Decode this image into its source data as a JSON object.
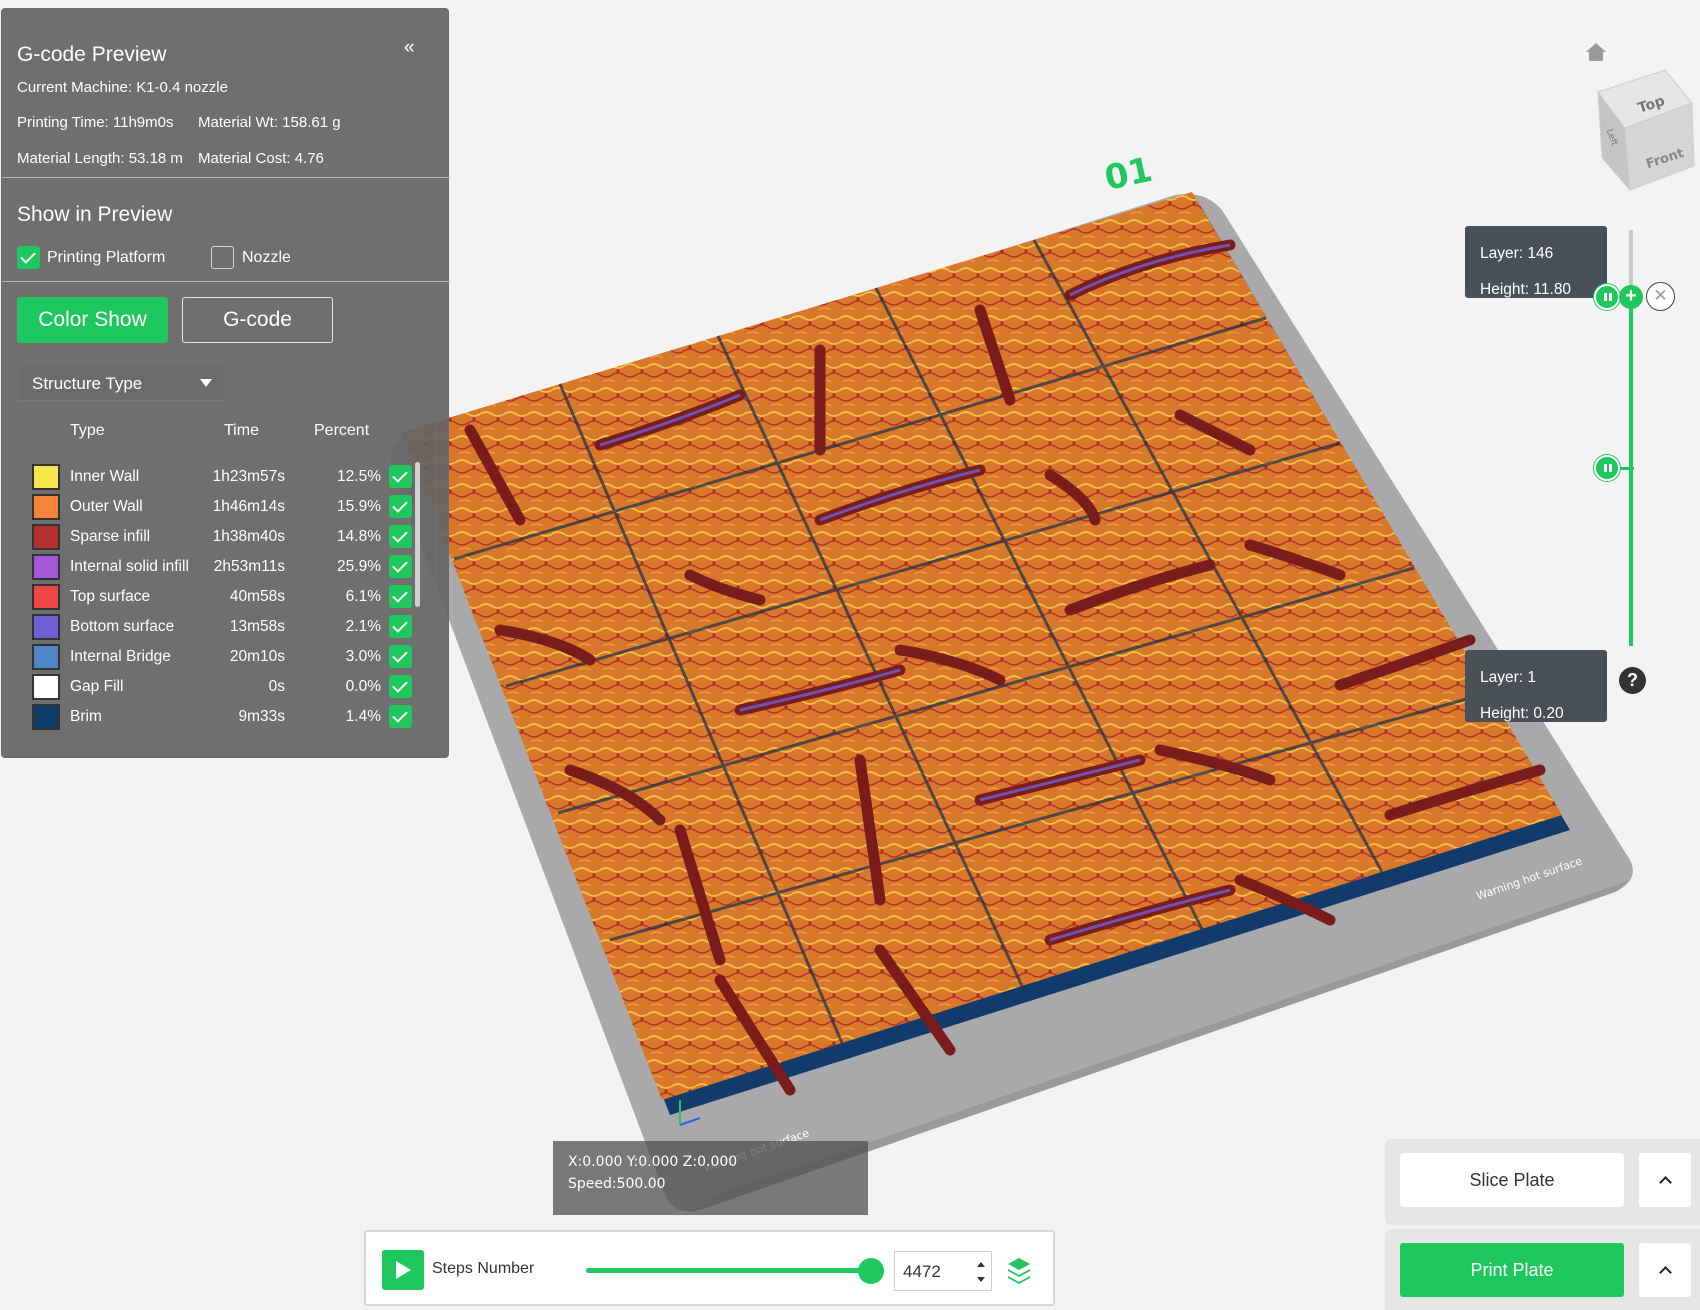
{
  "panel": {
    "title": "G-code Preview",
    "collapse_label": "«",
    "current_machine": "Current Machine: K1-0.4 nozzle",
    "printing_time": "Printing Time: 11h9m0s",
    "material_wt": "Material Wt: 158.61 g",
    "material_length": "Material Length: 53.18 m",
    "material_cost": "Material Cost: 4.76"
  },
  "show_in_preview": {
    "title": "Show in Preview",
    "printing_platform": {
      "label": "Printing Platform",
      "checked": true
    },
    "nozzle": {
      "label": "Nozzle",
      "checked": false
    }
  },
  "tabs": {
    "color_show": "Color Show",
    "gcode": "G-code",
    "active": "Color Show"
  },
  "structure_select": {
    "value": "Structure Type"
  },
  "legend": {
    "headers": {
      "type": "Type",
      "time": "Time",
      "percent": "Percent"
    },
    "rows": [
      {
        "type": "Inner Wall",
        "time": "1h23m57s",
        "percent": "12.5%",
        "color": "#f6e84a",
        "checked": true
      },
      {
        "type": "Outer Wall",
        "time": "1h46m14s",
        "percent": "15.9%",
        "color": "#f5843a",
        "checked": true
      },
      {
        "type": "Sparse infill",
        "time": "1h38m40s",
        "percent": "14.8%",
        "color": "#b3302c",
        "checked": true
      },
      {
        "type": "Internal solid infill",
        "time": "2h53m11s",
        "percent": "25.9%",
        "color": "#a656d8",
        "checked": true
      },
      {
        "type": "Top surface",
        "time": "40m58s",
        "percent": "6.1%",
        "color": "#f24545",
        "checked": true
      },
      {
        "type": "Bottom surface",
        "time": "13m58s",
        "percent": "2.1%",
        "color": "#6f60d8",
        "checked": true
      },
      {
        "type": "Internal Bridge",
        "time": "20m10s",
        "percent": "3.0%",
        "color": "#4f87c6",
        "checked": true
      },
      {
        "type": "Gap Fill",
        "time": "0s",
        "percent": "0.0%",
        "color": "#ffffff",
        "checked": true
      },
      {
        "type": "Brim",
        "time": "9m33s",
        "percent": "1.4%",
        "color": "#0c3b6a",
        "checked": true
      }
    ]
  },
  "layer_slider": {
    "top": {
      "layer": "Layer: 146",
      "height": "Height: 11.80"
    },
    "bottom": {
      "layer": "Layer: 1",
      "height": "Height: 0.20"
    },
    "plus": "+",
    "close": "✕",
    "help": "?"
  },
  "plate": {
    "label": "01",
    "warning": "Warning hot surface"
  },
  "view_cube": {
    "top": "Top",
    "front": "Front",
    "left": "Left"
  },
  "coords": {
    "xyz": "X:0.000  Y:0.000  Z:0.000",
    "speed": "Speed:500.00"
  },
  "steps": {
    "label": "Steps Number",
    "value": "4472",
    "progress": 1.0
  },
  "actions": {
    "slice": "Slice Plate",
    "print": "Print Plate"
  },
  "colors": {
    "accent": "#1fc85e",
    "panel_bg": "#646464",
    "plate": "#a9a9ab",
    "model": "#d9782a"
  }
}
